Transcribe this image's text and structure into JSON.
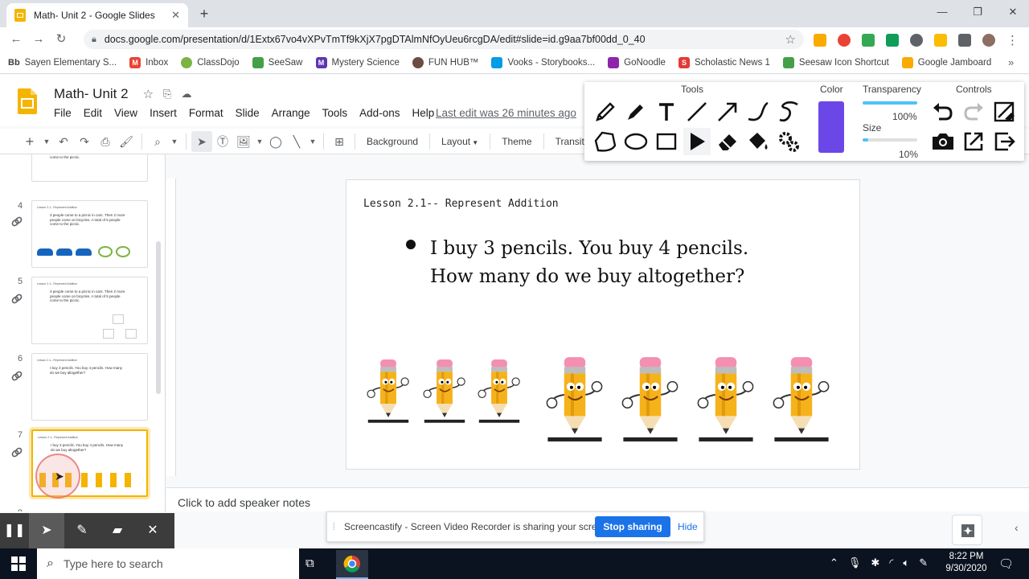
{
  "browser": {
    "tab_title": "Math- Unit 2 - Google Slides",
    "url": "docs.google.com/presentation/d/1Extx67vo4vXPvTmTf9kXjX7pgDTAlmNfOyUeu6rcgDA/edit#slide=id.g9aa7bf00dd_0_40",
    "bookmarks": [
      "Sayen Elementary S...",
      "Inbox",
      "ClassDojo",
      "SeeSaw",
      "Mystery Science",
      "FUN HUB™",
      "Vooks - Storybooks...",
      "GoNoodle",
      "Scholastic News 1",
      "Seesaw Icon Shortcut",
      "Google Jamboard"
    ],
    "bookmark_prefix": "Bb"
  },
  "app": {
    "title": "Math- Unit 2",
    "menu": [
      "File",
      "Edit",
      "View",
      "Insert",
      "Format",
      "Slide",
      "Arrange",
      "Tools",
      "Add-ons",
      "Help"
    ],
    "last_edit": "Last edit was 26 minutes ago",
    "toolbar_text": {
      "background": "Background",
      "layout": "Layout",
      "theme": "Theme",
      "transition": "Transition"
    }
  },
  "filmstrip": {
    "slides": [
      {
        "num": "4",
        "title": "Lesson 2.1-- Represent Addition",
        "text": "3 people come to a picnic in cars. Then 2 more people come on bicycles. A total of 5 people come to the picnic."
      },
      {
        "num": "5",
        "title": "Lesson 2.1-- Represent Addition",
        "text": "3 people come to a picnic in cars. Then 2 more people come on bicycles. A total of 5 people come to the picnic."
      },
      {
        "num": "6",
        "title": "Lesson 2.1-- Represent Addition",
        "text": "I buy 3 pencils. You buy 4 pencils. How many do we buy altogether?"
      },
      {
        "num": "7",
        "title": "Lesson 2.1-- Represent Addition",
        "text": "I buy 3 pencils. You buy 4 pencils. How many do we buy altogether?"
      }
    ],
    "top_partial_text": "come to the picnic.",
    "next_num": "8"
  },
  "slide": {
    "lesson_title": "Lesson 2.1-- Represent Addition",
    "bullet": "I buy 3 pencils. You buy 4 pencils. How many do we buy altogether?",
    "group1_count": 3,
    "group2_count": 4
  },
  "notes_placeholder": "Click to add speaker notes",
  "drawing_panel": {
    "tools_label": "Tools",
    "color_label": "Color",
    "transparency_label": "Transparency",
    "transparency_value": "100%",
    "size_label": "Size",
    "size_value": "10%",
    "controls_label": "Controls",
    "color": "#6c47e8"
  },
  "sharebar": {
    "message": "Screencastify - Screen Video Recorder is sharing your screen.",
    "stop": "Stop sharing",
    "hide": "Hide"
  },
  "taskbar": {
    "search_placeholder": "Type here to search",
    "time": "8:22 PM",
    "date": "9/30/2020"
  }
}
